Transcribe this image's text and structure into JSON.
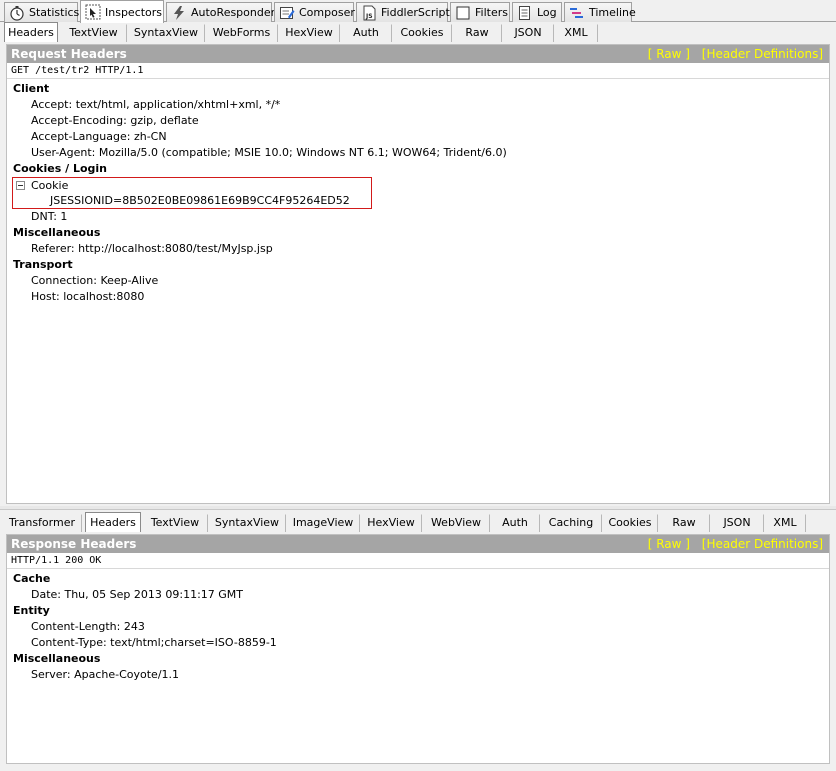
{
  "main_tabs": [
    {
      "label": "Statistics",
      "icon": "stopwatch-icon"
    },
    {
      "label": "Inspectors",
      "icon": "inspect-icon"
    },
    {
      "label": "AutoResponder",
      "icon": "lightning-icon"
    },
    {
      "label": "Composer",
      "icon": "composer-icon"
    },
    {
      "label": "FiddlerScript",
      "icon": "script-icon"
    },
    {
      "label": "Filters",
      "icon": "checkbox-icon"
    },
    {
      "label": "Log",
      "icon": "log-icon"
    },
    {
      "label": "Timeline",
      "icon": "timeline-icon"
    }
  ],
  "active_main_tab": "Inspectors",
  "request_tabs": [
    "Headers",
    "TextView",
    "SyntaxView",
    "WebForms",
    "HexView",
    "Auth",
    "Cookies",
    "Raw",
    "JSON",
    "XML"
  ],
  "active_request_tab": "Headers",
  "request": {
    "title": "Request Headers",
    "link_raw": "[ Raw ]",
    "link_defs": "[Header Definitions]",
    "request_line": "GET /test/tr2 HTTP/1.1",
    "groups": {
      "client": {
        "title": "Client",
        "items": [
          "Accept: text/html, application/xhtml+xml, */*",
          "Accept-Encoding: gzip, deflate",
          "Accept-Language: zh-CN",
          "User-Agent: Mozilla/5.0 (compatible; MSIE 10.0; Windows NT 6.1; WOW64; Trident/6.0)"
        ]
      },
      "cookies": {
        "title": "Cookies / Login",
        "cookie_label": "Cookie",
        "cookie_value": "JSESSIONID=8B502E0BE09861E69B9CC4F95264ED52",
        "dnt": "DNT: 1"
      },
      "misc": {
        "title": "Miscellaneous",
        "items": [
          "Referer: http://localhost:8080/test/MyJsp.jsp"
        ]
      },
      "transport": {
        "title": "Transport",
        "items": [
          "Connection: Keep-Alive",
          "Host: localhost:8080"
        ]
      }
    }
  },
  "response_tabs": [
    "Transformer",
    "Headers",
    "TextView",
    "SyntaxView",
    "ImageView",
    "HexView",
    "WebView",
    "Auth",
    "Caching",
    "Cookies",
    "Raw",
    "JSON",
    "XML"
  ],
  "active_response_tab": "Headers",
  "response": {
    "title": "Response Headers",
    "link_raw": "[ Raw ]",
    "link_defs": "[Header Definitions]",
    "status_line": "HTTP/1.1 200 OK",
    "groups": {
      "cache": {
        "title": "Cache",
        "items": [
          "Date: Thu, 05 Sep 2013 09:11:17 GMT"
        ]
      },
      "entity": {
        "title": "Entity",
        "items": [
          "Content-Length: 243",
          "Content-Type: text/html;charset=ISO-8859-1"
        ]
      },
      "misc": {
        "title": "Miscellaneous",
        "items": [
          "Server: Apache-Coyote/1.1"
        ]
      }
    }
  },
  "colors": {
    "header_bar": "#a5a5a5",
    "header_text": "#ffffff",
    "link_text": "#ffff00",
    "highlight_box": "#d21a1a"
  }
}
